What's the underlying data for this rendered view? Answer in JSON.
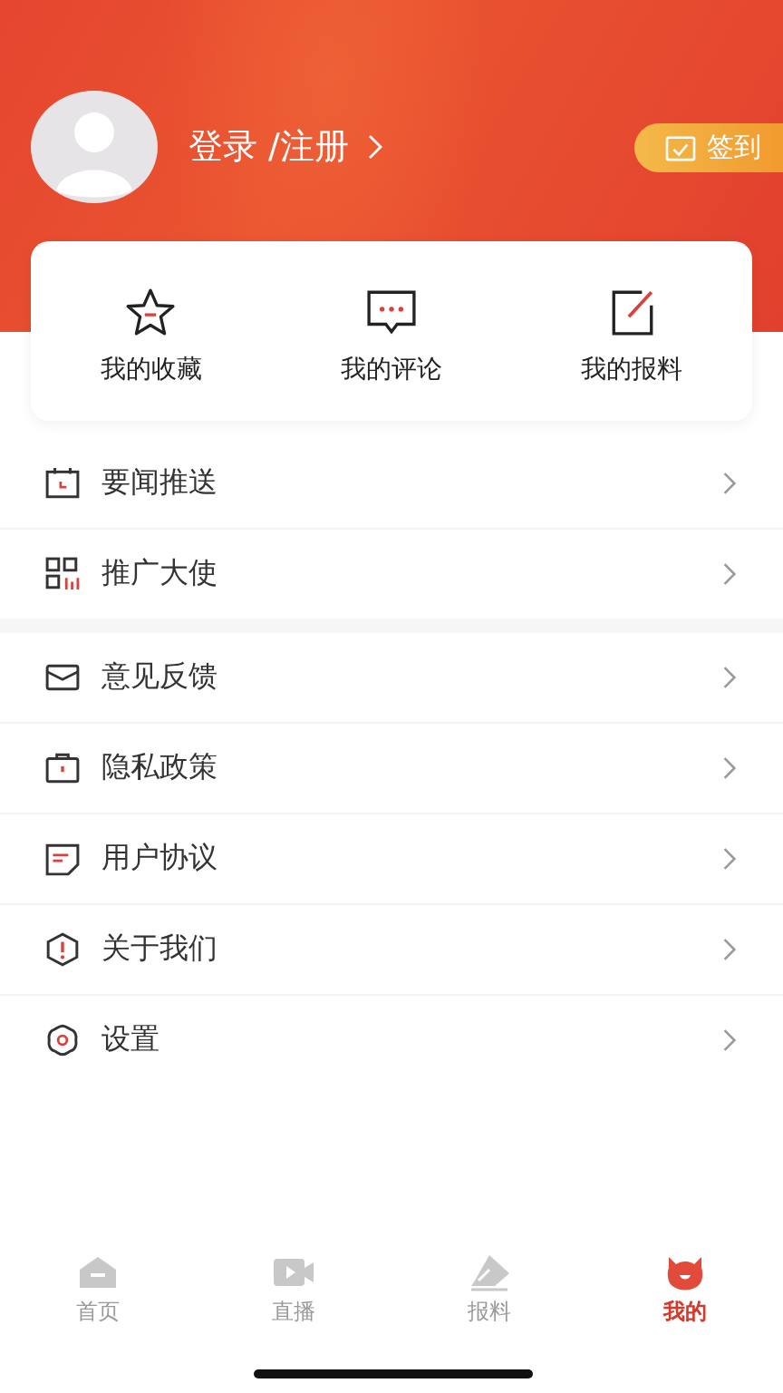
{
  "profile": {
    "login_label": "登录 /注册",
    "checkin_label": "签到"
  },
  "shortcuts": [
    {
      "label": "我的收藏"
    },
    {
      "label": "我的评论"
    },
    {
      "label": "我的报料"
    }
  ],
  "menu_groups": [
    [
      {
        "label": "要闻推送"
      },
      {
        "label": "推广大使"
      }
    ],
    [
      {
        "label": "意见反馈"
      },
      {
        "label": "隐私政策"
      },
      {
        "label": "用户协议"
      },
      {
        "label": "关于我们"
      },
      {
        "label": "设置"
      }
    ]
  ],
  "tabs": [
    {
      "label": "首页",
      "selected": false
    },
    {
      "label": "直播",
      "selected": false
    },
    {
      "label": "报料",
      "selected": false
    },
    {
      "label": "我的",
      "selected": true
    }
  ]
}
